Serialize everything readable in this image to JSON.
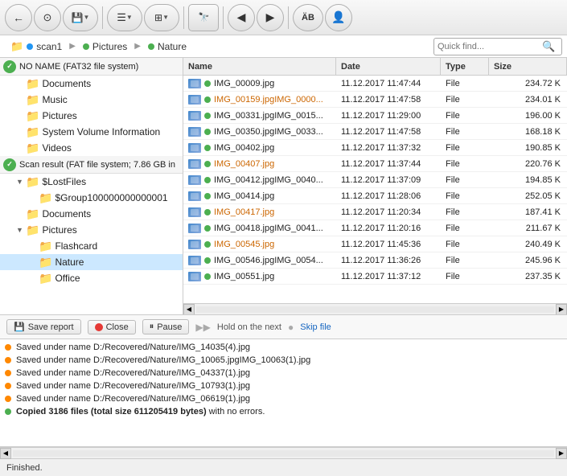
{
  "toolbar": {
    "buttons": [
      {
        "id": "back",
        "icon": "←",
        "label": "Back"
      },
      {
        "id": "search",
        "icon": "🔍",
        "label": "Search"
      },
      {
        "id": "save",
        "icon": "💾",
        "label": "Save",
        "has_arrow": true
      },
      {
        "id": "list",
        "icon": "≡",
        "label": "List",
        "has_arrow": true
      },
      {
        "id": "grid",
        "icon": "⊞",
        "label": "Grid",
        "has_arrow": true
      },
      {
        "id": "binoculars",
        "icon": "🔭",
        "label": "Scan"
      },
      {
        "id": "prev",
        "icon": "◀",
        "label": "Previous"
      },
      {
        "id": "next",
        "icon": "▶",
        "label": "Next"
      },
      {
        "id": "ab",
        "icon": "ÄB",
        "label": "AB"
      },
      {
        "id": "user",
        "icon": "👤",
        "label": "User"
      }
    ]
  },
  "breadcrumb": {
    "segments": [
      {
        "label": "scan1",
        "dot_color": "blue"
      },
      {
        "label": "Pictures",
        "dot_color": "green"
      },
      {
        "label": "Nature",
        "dot_color": "green"
      }
    ]
  },
  "search": {
    "placeholder": "Quick find..."
  },
  "tree": {
    "sections": [
      {
        "id": "fat32",
        "label": "NO NAME (FAT32 file system)",
        "type": "volume",
        "items": [
          {
            "label": "Documents",
            "indent": 1,
            "type": "folder"
          },
          {
            "label": "Music",
            "indent": 1,
            "type": "folder"
          },
          {
            "label": "Pictures",
            "indent": 1,
            "type": "folder"
          },
          {
            "label": "System Volume Information",
            "indent": 1,
            "type": "folder"
          },
          {
            "label": "Videos",
            "indent": 1,
            "type": "folder"
          }
        ]
      },
      {
        "id": "fat",
        "label": "Scan result (FAT file system; 7.86 GB in",
        "type": "volume",
        "items": [
          {
            "label": "$LostFiles",
            "indent": 1,
            "type": "folder",
            "expanded": true
          },
          {
            "label": "$Group100000000000001",
            "indent": 2,
            "type": "folder"
          },
          {
            "label": "Documents",
            "indent": 1,
            "type": "folder"
          },
          {
            "label": "Pictures",
            "indent": 1,
            "type": "folder",
            "expanded": true
          },
          {
            "label": "Flashcard",
            "indent": 2,
            "type": "folder"
          },
          {
            "label": "Nature",
            "indent": 2,
            "type": "folder",
            "selected": true
          },
          {
            "label": "Office",
            "indent": 2,
            "type": "folder"
          }
        ]
      }
    ]
  },
  "file_list": {
    "headers": [
      "Name",
      "Date",
      "Type",
      "Size"
    ],
    "files": [
      {
        "name": "IMG_00009.jpg",
        "date": "11.12.2017 11:47:44",
        "type": "File",
        "size": "234.72 K",
        "status": "green",
        "orange": false
      },
      {
        "name": "IMG_00159.jpgIMG_0000...",
        "date": "11.12.2017 11:47:58",
        "type": "File",
        "size": "234.01 K",
        "status": "green",
        "orange": true
      },
      {
        "name": "IMG_00331.jpgIMG_0015...",
        "date": "11.12.2017 11:29:00",
        "type": "File",
        "size": "196.00 K",
        "status": "green",
        "orange": false
      },
      {
        "name": "IMG_00350.jpgIMG_0033...",
        "date": "11.12.2017 11:47:58",
        "type": "File",
        "size": "168.18 K",
        "status": "green",
        "orange": false
      },
      {
        "name": "IMG_00402.jpg",
        "date": "11.12.2017 11:37:32",
        "type": "File",
        "size": "190.85 K",
        "status": "green",
        "orange": false
      },
      {
        "name": "IMG_00407.jpg",
        "date": "11.12.2017 11:37:44",
        "type": "File",
        "size": "220.76 K",
        "status": "green",
        "orange": true
      },
      {
        "name": "IMG_00412.jpgIMG_0040...",
        "date": "11.12.2017 11:37:09",
        "type": "File",
        "size": "194.85 K",
        "status": "green",
        "orange": false
      },
      {
        "name": "IMG_00414.jpg",
        "date": "11.12.2017 11:28:06",
        "type": "File",
        "size": "252.05 K",
        "status": "green",
        "orange": false
      },
      {
        "name": "IMG_00417.jpg",
        "date": "11.12.2017 11:20:34",
        "type": "File",
        "size": "187.41 K",
        "status": "green",
        "orange": true
      },
      {
        "name": "IMG_00418.jpgIMG_0041...",
        "date": "11.12.2017 11:20:16",
        "type": "File",
        "size": "211.67 K",
        "status": "green",
        "orange": false
      },
      {
        "name": "IMG_00545.jpg",
        "date": "11.12.2017 11:45:36",
        "type": "File",
        "size": "240.49 K",
        "status": "green",
        "orange": true
      },
      {
        "name": "IMG_00546.jpgIMG_0054...",
        "date": "11.12.2017 11:36:26",
        "type": "File",
        "size": "245.96 K",
        "status": "green",
        "orange": false
      },
      {
        "name": "IMG_00551.jpg",
        "date": "11.12.2017 11:37:12",
        "type": "File",
        "size": "237.35 K",
        "status": "green",
        "orange": false
      }
    ]
  },
  "status_bar": {
    "save_report": "Save report",
    "close": "Close",
    "pause": "Pause",
    "hold_next": "Hold on the next",
    "skip_file": "Skip file"
  },
  "log": {
    "lines": [
      {
        "text": "Saved under name D:/Recovered/Nature/IMG_14035(4).jpg",
        "dot": "orange"
      },
      {
        "text": "Saved under name D:/Recovered/Nature/IMG_10065.jpgIMG_10063(1).jpg",
        "dot": "orange"
      },
      {
        "text": "Saved under name D:/Recovered/Nature/IMG_04337(1).jpg",
        "dot": "orange"
      },
      {
        "text": "Saved under name D:/Recovered/Nature/IMG_10793(1).jpg",
        "dot": "orange"
      },
      {
        "text": "Saved under name D:/Recovered/Nature/IMG_06619(1).jpg",
        "dot": "orange"
      },
      {
        "text": "Copied 3186 files (total size 611205419 bytes) with no errors.",
        "dot": "green",
        "bold_end": true
      }
    ]
  },
  "bottom_status": {
    "text": "Finished."
  }
}
